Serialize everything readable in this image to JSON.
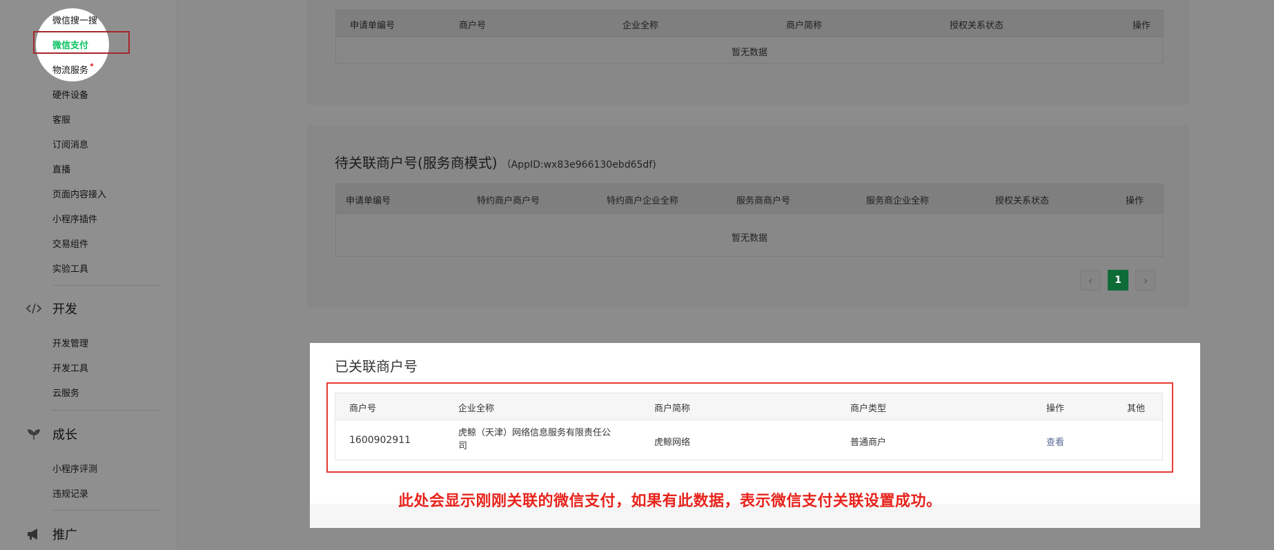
{
  "sidebar": {
    "items_top": [
      {
        "label": "微信搜一搜",
        "name": "sidebar-item-weixin-search",
        "active": false
      },
      {
        "label": "微信支付",
        "name": "sidebar-item-wechat-pay",
        "active": true
      },
      {
        "label": "物流服务",
        "name": "sidebar-item-logistics",
        "active": false,
        "dot": true
      },
      {
        "label": "硬件设备",
        "name": "sidebar-item-hardware"
      },
      {
        "label": "客服",
        "name": "sidebar-item-customer-service"
      },
      {
        "label": "订阅消息",
        "name": "sidebar-item-subscribe-message"
      },
      {
        "label": "直播",
        "name": "sidebar-item-live"
      },
      {
        "label": "页面内容接入",
        "name": "sidebar-item-page-content"
      },
      {
        "label": "小程序插件",
        "name": "sidebar-item-plugins"
      },
      {
        "label": "交易组件",
        "name": "sidebar-item-trade-component"
      },
      {
        "label": "实验工具",
        "name": "sidebar-item-experiment-tools"
      }
    ],
    "section_dev": {
      "title": "开发",
      "icon": "code-icon"
    },
    "items_dev": [
      {
        "label": "开发管理",
        "name": "sidebar-item-dev-management"
      },
      {
        "label": "开发工具",
        "name": "sidebar-item-dev-tools"
      },
      {
        "label": "云服务",
        "name": "sidebar-item-cloud-service"
      }
    ],
    "section_growth": {
      "title": "成长",
      "icon": "sprout-icon"
    },
    "items_growth": [
      {
        "label": "小程序评测",
        "name": "sidebar-item-evaluation"
      },
      {
        "label": "违规记录",
        "name": "sidebar-item-violations"
      }
    ],
    "section_promo": {
      "title": "推广",
      "icon": "megaphone-icon"
    }
  },
  "top_table": {
    "headers": [
      "申请单编号",
      "商户号",
      "企业全称",
      "商户简称",
      "授权关系状态",
      "操作"
    ],
    "empty_text": "暂无数据"
  },
  "pending": {
    "title": "待关联商户号(服务商模式)",
    "appid": "（AppID:wx83e966130ebd65df)",
    "headers": [
      "申请单编号",
      "特约商户商户号",
      "特约商户企业全称",
      "服务商商户号",
      "服务商企业全称",
      "授权关系状态",
      "操作"
    ],
    "empty_text": "暂无数据",
    "pagination": {
      "prev": "‹",
      "current": "1",
      "next": "›"
    }
  },
  "linked": {
    "title": "已关联商户号",
    "headers": [
      "商户号",
      "企业全称",
      "商户简称",
      "商户类型",
      "操作",
      "其他"
    ],
    "row": {
      "merchant_id": "1600902911",
      "company_line1": "虎鲸（天津）网络信息服务有限责任公",
      "company_line2": "司",
      "short_name": "虎鲸网络",
      "type": "普通商户",
      "action": "查看",
      "other": ""
    }
  },
  "annotation": "此处会显示刚刚关联的微信支付，如果有此数据，表示微信支付关联设置成功。",
  "colors": {
    "accent_green": "#07c160",
    "annotation_red": "#e7231c",
    "link": "#576b95"
  }
}
